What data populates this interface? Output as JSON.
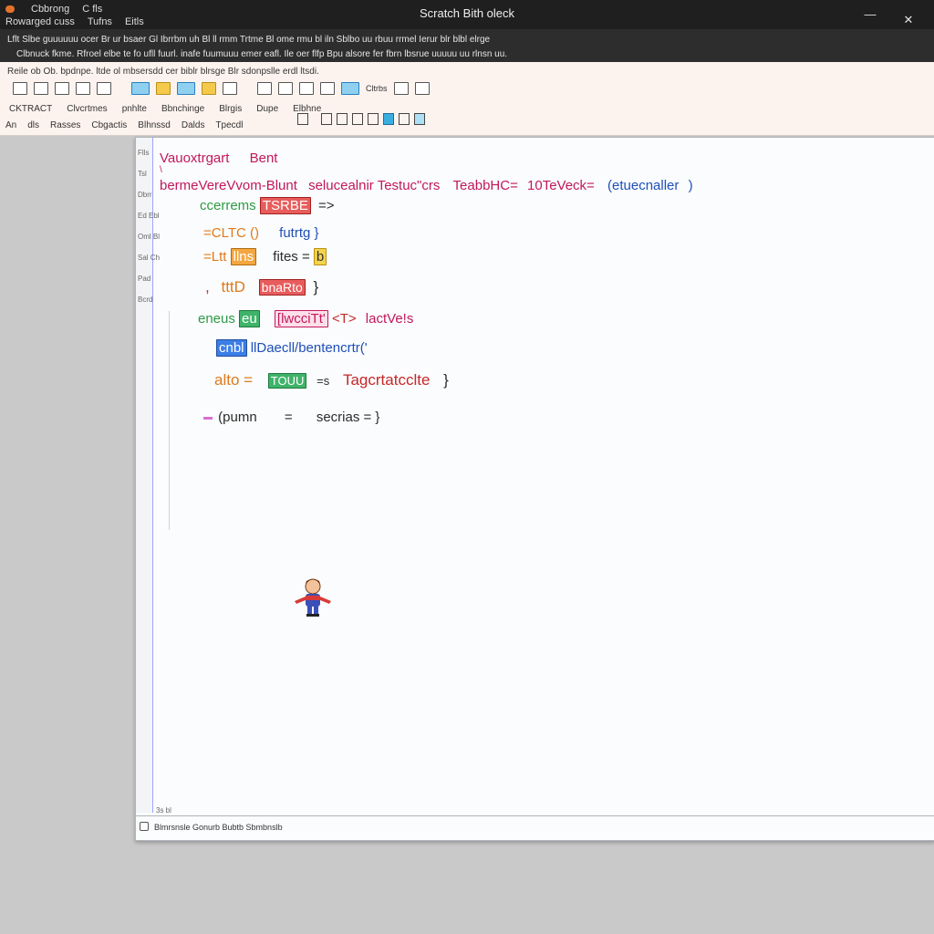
{
  "titlebar": {
    "app_line1": "Cbbrong",
    "app_line1b": "C fls",
    "app_line2": [
      "Rowarged cuss",
      "Tufns",
      "Eitls"
    ],
    "title": "Scratch Bith oleck",
    "minimize": "—",
    "close": "✕"
  },
  "menubar": {
    "line1": "Lflt Slbe guuuuuu ocer Br ur bsaer Gl Ibrrbm uh Bl ll rmm Trtme Bl ome rmu bl iln Sblbo uu rbuu rrmel Ierur blr blbl elrge",
    "line2": "Clbnuck fkme. Rfroel elbe te fo ufll fuurl. inafe fuumuuu emer eafl. Ile oer flfp Bpu alsore fer fbrn lbsrue uuuuu uu rlnsn uu."
  },
  "ribbon": {
    "crumb": "Reile ob Ob. bpdnpe. ltde ol mbsersdd cer biblr blrsge Blr sdonpslle erdl ltsdi.",
    "toolbar1_label": "Cltrbs",
    "toolbar2": [
      "CKTRACT",
      "Clvcrtmes",
      "pnhlte",
      "Bbnchinge",
      "Blrgis",
      "Dupe",
      "Elbhne"
    ],
    "toolbar3": [
      "An",
      "dls",
      "Rasses",
      "Cbgactis",
      "Blhnssd",
      "Dalds",
      "Tpecdl"
    ]
  },
  "editor": {
    "line_labels": [
      "Flls",
      "Tsl",
      "Dbrr",
      "Ed Ebl",
      "Oml Bl",
      "Sal Ch",
      "Pad",
      "Bcrd"
    ],
    "code": {
      "l1a": "Vauoxtrgart",
      "l1b": "Bent",
      "l2": "\\",
      "l3a": "bermeVereVvom-Blunt",
      "l3b": "selucealnir",
      "l3c": "Testuc\"crs",
      "l3d": "TeabbHC=",
      "l3e": "10TeVeck=",
      "l3f": "(etuecnaller",
      "l3g": ")",
      "l4a": "ccerrems",
      "l4b": "TSRBE",
      "l4c": "=>",
      "l5a": "=CLTC ()",
      "l5b": "futrtg }",
      "l6a": "=Ltt",
      "l6b": "llns",
      "l6c": "fites =",
      "l6d": "b",
      "l7a": "tttD",
      "l7b": "bnaRto",
      "l7c": "}",
      "l8a": "eneus",
      "l8b": "eu",
      "l8c": "[lwcciTt'",
      "l8d": "<T>",
      "l8e": "lactVe!s",
      "l9a": "cnbl",
      "l9b": "llDaecll/bentencrtr('",
      "l10a": "alto =",
      "l10b": "TOUU",
      "l10c": "=s",
      "l10d": "Tagcrtatcclte",
      "l10e": "}",
      "l11a": "(pumn",
      "l11b": "=",
      "l11c": "secrias = }"
    },
    "status_prev": "3s bl",
    "status": "Blmrsnsle Gonurb Bubtb Sbmbnslb"
  },
  "colors": {
    "title_bg": "#1f1f1f",
    "menu_bg": "#2d2d2d",
    "ribbon_bg": "#fdf3ee",
    "editor_bg": "#fafcfd",
    "accent": "#c2185b"
  }
}
